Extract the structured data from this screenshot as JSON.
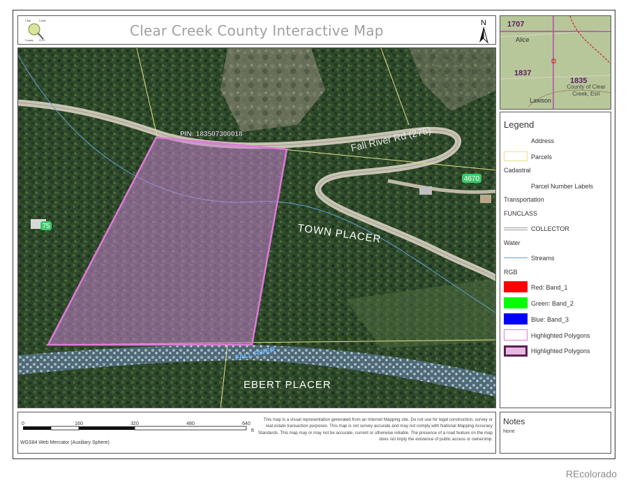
{
  "title": "Clear Creek County Interactive Map",
  "logo": {
    "line1": "Clear",
    "line2": "Creek",
    "line3": "County",
    "line4": "G.I.S."
  },
  "north_label": "N",
  "map": {
    "parcel_label": "PIN: 183507300018",
    "road_label": "Fall River Rd (275)",
    "area_label_1": "TOWN PLACER",
    "area_label_2": "EBERT PLACER",
    "river_label": "FALL RIVER",
    "address_1": "4670",
    "address_2": "75"
  },
  "overview": {
    "labels": [
      "1707",
      "1837",
      "1835"
    ],
    "places": [
      "Alice",
      "Lawson"
    ],
    "credit": "County of Clear Creek, Esri"
  },
  "legend": {
    "title": "Legend",
    "items": {
      "address": "Address",
      "parcels": "Parcels",
      "cadastral": "Cadastral",
      "parcel_number_labels": "Parcel Number Labels",
      "transportation": "Transportation",
      "funclass": "FUNCLASS",
      "collector": "COLLECTOR",
      "water": "Water",
      "streams": "Streams",
      "rgb": "RGB",
      "red": "Red:  Band_1",
      "green": "Green: Band_2",
      "blue": "Blue:  Band_3",
      "highlighted_1": "Highlighted Polygons",
      "highlighted_2": "Highlighted Polygons"
    },
    "colors": {
      "red": "#ff0000",
      "green": "#00ff00",
      "blue": "#0000ff",
      "highlight": "#e07ad8",
      "parcel": "#e8e08a"
    }
  },
  "scalebar": {
    "ticks": [
      "0",
      "160",
      "320",
      "480",
      "640"
    ],
    "unit": "ft",
    "projection": "WGS84 Web Mercator (Auxiliary Sphere)"
  },
  "disclaimer": "This map is a visual representation generated from an Internet Mapping site. Do not use for legal construction, survey or real estate transaction purposes. This map is not survey accurate and may not comply with National Mapping Accuracy Standards. This map may or may not be accurate, current or otherwise reliable. The presence of a road feature on the map does not imply the existence of public access or ownership.",
  "notes": {
    "title": "Notes",
    "body": "None"
  },
  "watermark": "REcolorado"
}
